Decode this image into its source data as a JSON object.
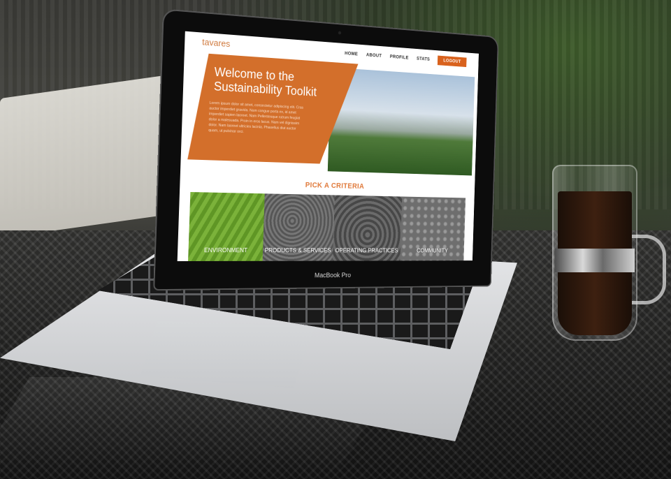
{
  "website": {
    "logo": "tavares",
    "nav": [
      "HOME",
      "ABOUT",
      "PROFILE",
      "STATS"
    ],
    "logout": "LOGOUT",
    "hero_title": "Welcome to the Sustainability Toolkit",
    "hero_body": "Lorem ipsum dolor sit amet, consectetur adipiscing elit. Cras auctor imperdiet gravida. Nam congue porta ex, id amet imperdiet sapien laoreet. Nam Pellentesque rutrum feugiat dolor a malesuada. Proin in eros lacus. Nam vel dignissim dolor. Nam laoreet ultricies lacinia. Phasellus diut auctor quam, ut pulvinar orci.",
    "section_title": "PICK A CRITERIA",
    "tiles": [
      "ENVIRONMENT",
      "PRODUCTS & SERVICES",
      "OPERATING PRACTICES",
      "COMMUNITY"
    ]
  },
  "device": {
    "label": "MacBook Pro"
  },
  "colors": {
    "accent": "#d9621d",
    "hero": "#d36f2b"
  }
}
